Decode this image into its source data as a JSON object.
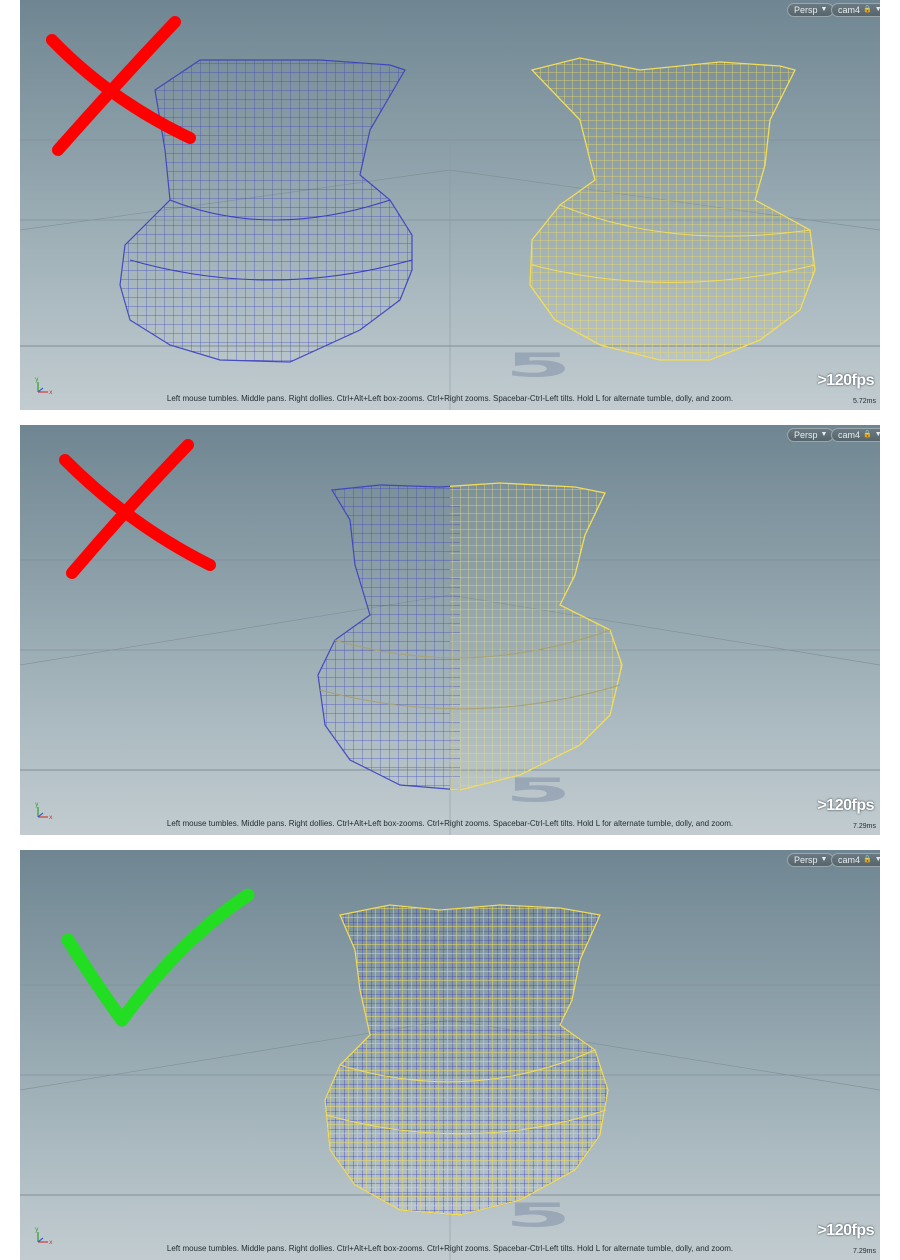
{
  "panels": [
    {
      "camera_mode": "Persp",
      "camera_name": "cam4",
      "help_text": "Left mouse tumbles. Middle pans. Right dollies. Ctrl+Alt+Left box-zooms. Ctrl+Right zooms. Spacebar-Ctrl-Left tilts. Hold L for alternate tumble, dolly, and zoom.",
      "fps": ">120fps",
      "frame_time": "5.72ms",
      "annotation": "cross-mark"
    },
    {
      "camera_mode": "Persp",
      "camera_name": "cam4",
      "help_text": "Left mouse tumbles. Middle pans. Right dollies. Ctrl+Alt+Left box-zooms. Ctrl+Right zooms. Spacebar-Ctrl-Left tilts. Hold L for alternate tumble, dolly, and zoom.",
      "fps": ">120fps",
      "frame_time": "7.29ms",
      "annotation": "cross-mark"
    },
    {
      "camera_mode": "Persp",
      "camera_name": "cam4",
      "help_text": "Left mouse tumbles. Middle pans. Right dollies. Ctrl+Alt+Left box-zooms. Ctrl+Right zooms. Spacebar-Ctrl-Left tilts. Hold L for alternate tumble, dolly, and zoom.",
      "fps": ">120fps",
      "frame_time": "7.29ms",
      "annotation": "check-mark"
    }
  ],
  "axis_labels": {
    "y": "y",
    "x": "x"
  },
  "colors": {
    "blue_wireframe": "#3b3fbf",
    "yellow_wireframe": "#f2dc5a",
    "cross_mark": "#ff0000",
    "check_mark": "#22dd22",
    "viewport_top": "#6f8692",
    "viewport_bottom": "#c2ccd0"
  }
}
